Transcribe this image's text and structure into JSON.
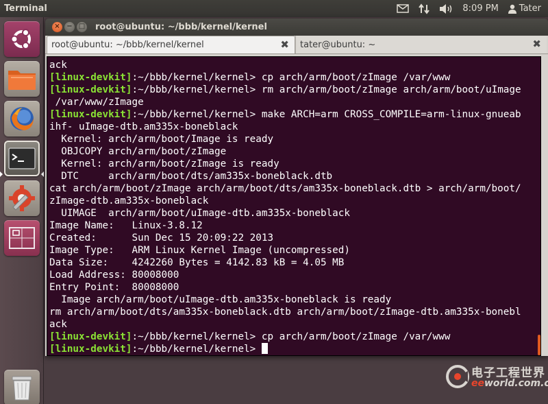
{
  "top_panel": {
    "app_title": "Terminal",
    "time": "8:09 PM",
    "user": "Tater",
    "icons": [
      "mail-icon",
      "network-updown-icon",
      "volume-icon",
      "user-icon"
    ]
  },
  "launcher": {
    "items": [
      {
        "name": "dash-home",
        "icon": "ubuntu-logo-icon"
      },
      {
        "name": "files",
        "icon": "folder-icon"
      },
      {
        "name": "firefox",
        "icon": "firefox-icon"
      },
      {
        "name": "terminal",
        "icon": "terminal-icon",
        "active": true
      },
      {
        "name": "system-settings",
        "icon": "settings-icon"
      },
      {
        "name": "workspace-switcher",
        "icon": "workspace-icon"
      },
      {
        "name": "trash",
        "icon": "trash-icon"
      }
    ]
  },
  "window": {
    "title": "root@ubuntu: ~/bbb/kernel/kernel",
    "tabs": [
      {
        "label": "root@ubuntu: ~/bbb/kernel/kernel",
        "close": "✖",
        "active": true
      },
      {
        "label": "tater@ubuntu: ~",
        "close": "✖",
        "active": false
      }
    ]
  },
  "terminal": {
    "prompt_user": "[linux-devkit]",
    "prompt_path": ":~/bbb/kernel/kernel> ",
    "lines": [
      {
        "type": "out",
        "text": "ack"
      },
      {
        "type": "prompt",
        "cmd": "cp arch/arm/boot/zImage /var/www"
      },
      {
        "type": "prompt",
        "cmd": "rm arch/arm/boot/zImage arch/arm/boot/uImage"
      },
      {
        "type": "out",
        "text": " /var/www/zImage"
      },
      {
        "type": "prompt",
        "cmd": "make ARCH=arm CROSS_COMPILE=arm-linux-gnueab"
      },
      {
        "type": "out",
        "text": "ihf- uImage-dtb.am335x-boneblack"
      },
      {
        "type": "out",
        "text": "  Kernel: arch/arm/boot/Image is ready"
      },
      {
        "type": "out",
        "text": "  OBJCOPY arch/arm/boot/zImage"
      },
      {
        "type": "out",
        "text": "  Kernel: arch/arm/boot/zImage is ready"
      },
      {
        "type": "out",
        "text": "  DTC     arch/arm/boot/dts/am335x-boneblack.dtb"
      },
      {
        "type": "out",
        "text": "cat arch/arm/boot/zImage arch/arm/boot/dts/am335x-boneblack.dtb > arch/arm/boot/"
      },
      {
        "type": "out",
        "text": "zImage-dtb.am335x-boneblack"
      },
      {
        "type": "out",
        "text": "  UIMAGE  arch/arm/boot/uImage-dtb.am335x-boneblack"
      },
      {
        "type": "out",
        "text": "Image Name:   Linux-3.8.12"
      },
      {
        "type": "out",
        "text": "Created:      Sun Dec 15 20:09:22 2013"
      },
      {
        "type": "out",
        "text": "Image Type:   ARM Linux Kernel Image (uncompressed)"
      },
      {
        "type": "out",
        "text": "Data Size:    4242260 Bytes = 4142.83 kB = 4.05 MB"
      },
      {
        "type": "out",
        "text": "Load Address: 80008000"
      },
      {
        "type": "out",
        "text": "Entry Point:  80008000"
      },
      {
        "type": "out",
        "text": "  Image arch/arm/boot/uImage-dtb.am335x-boneblack is ready"
      },
      {
        "type": "out",
        "text": "rm arch/arm/boot/dts/am335x-boneblack.dtb arch/arm/boot/zImage-dtb.am335x-bonebl"
      },
      {
        "type": "out",
        "text": "ack"
      },
      {
        "type": "prompt",
        "cmd": "cp arch/arm/boot/zImage /var/www"
      },
      {
        "type": "prompt",
        "cmd": "",
        "cursor": true
      }
    ]
  },
  "watermark": {
    "cn_text": "电子工程世界",
    "en_prefix": "ee",
    "en_rest": "world.com.cn"
  },
  "colors": {
    "terminal_bg": "#300a24",
    "prompt_green": "#8ae234",
    "accent_orange": "#e05a1f"
  }
}
